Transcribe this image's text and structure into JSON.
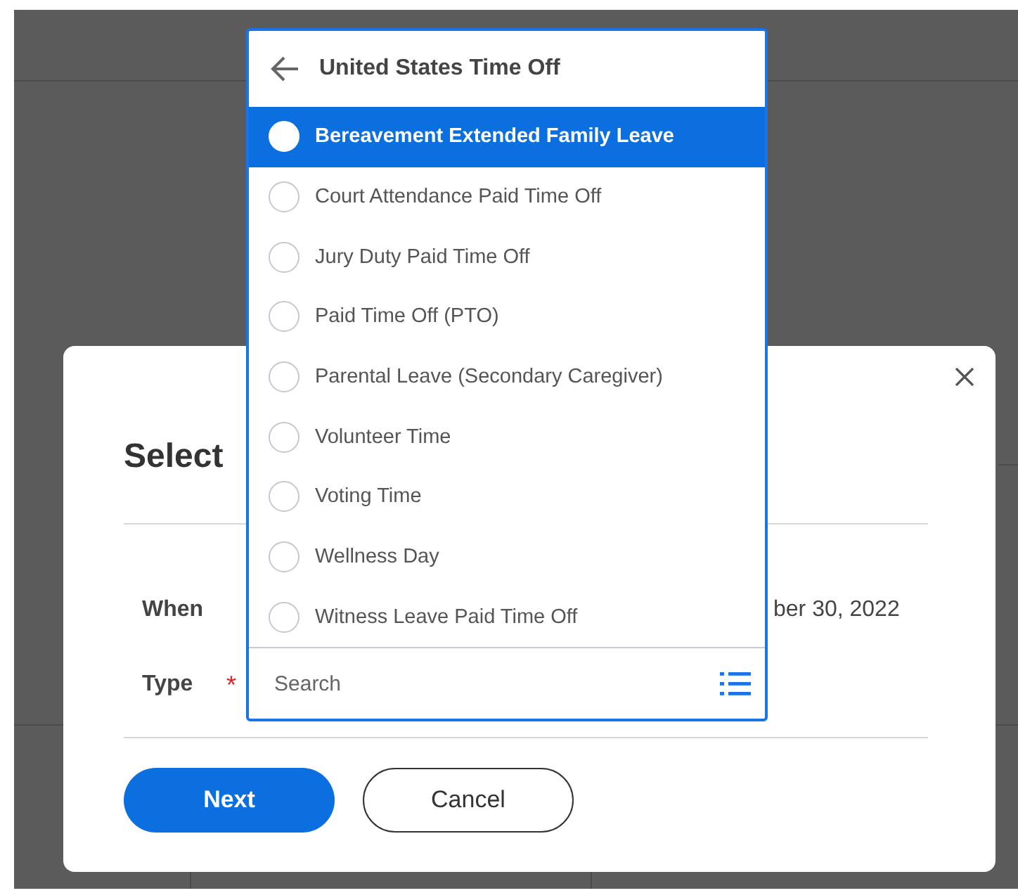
{
  "dialog": {
    "title": "Select",
    "fields": [
      {
        "label": "When",
        "value": "ber 30, 2022"
      },
      {
        "label": "Type",
        "required_mark": "*"
      }
    ],
    "buttons": [
      {
        "label": "Next",
        "kind": "primary"
      },
      {
        "label": "Cancel",
        "kind": "secondary"
      }
    ]
  },
  "dropdown": {
    "title": "United States Time Off",
    "items": [
      {
        "label": "Bereavement Extended Family Leave",
        "selected": true
      },
      {
        "label": "Court Attendance Paid Time Off",
        "selected": false
      },
      {
        "label": "Jury Duty Paid Time Off",
        "selected": false
      },
      {
        "label": "Paid Time Off (PTO)",
        "selected": false
      },
      {
        "label": "Parental Leave (Secondary Caregiver)",
        "selected": false
      },
      {
        "label": "Volunteer Time",
        "selected": false
      },
      {
        "label": "Voting Time",
        "selected": false
      },
      {
        "label": "Wellness Day",
        "selected": false
      },
      {
        "label": "Witness Leave Paid Time Off",
        "selected": false
      }
    ],
    "search": {
      "placeholder": "Search"
    }
  }
}
